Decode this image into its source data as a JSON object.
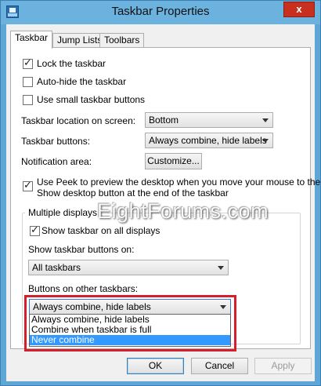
{
  "window": {
    "title": "Taskbar Properties",
    "close_label": "x",
    "icon": "taskbar-window-icon"
  },
  "tabs": [
    {
      "label": "Taskbar",
      "active": true
    },
    {
      "label": "Jump Lists",
      "active": false
    },
    {
      "label": "Toolbars",
      "active": false
    }
  ],
  "options": {
    "lock_taskbar": {
      "label": "Lock the taskbar",
      "checked": true
    },
    "auto_hide": {
      "label": "Auto-hide the taskbar",
      "checked": false
    },
    "small_buttons": {
      "label": "Use small taskbar buttons",
      "checked": false
    }
  },
  "location": {
    "label": "Taskbar location on screen:",
    "value": "Bottom"
  },
  "buttons_setting": {
    "label": "Taskbar buttons:",
    "value": "Always combine, hide labels"
  },
  "notification": {
    "label": "Notification area:",
    "button_label": "Customize..."
  },
  "peek": {
    "label_line1": "Use Peek to preview the desktop when you move your mouse to the",
    "label_line2": "Show desktop button at the end of the taskbar",
    "checked": true
  },
  "multiple_displays": {
    "group_title": "Multiple displays",
    "show_all": {
      "label": "Show taskbar on all displays",
      "checked": true
    },
    "show_buttons_on_label": "Show taskbar buttons on:",
    "show_buttons_on_value": "All taskbars",
    "other_taskbars_label": "Buttons on other taskbars:",
    "other_taskbars_value": "Always combine, hide labels",
    "dropdown_options": [
      {
        "label": "Always combine, hide labels",
        "selected": false
      },
      {
        "label": "Combine when taskbar is full",
        "selected": false
      },
      {
        "label": "Never combine",
        "selected": true
      }
    ]
  },
  "watermark": "EightForums.com",
  "footer": {
    "ok_label": "OK",
    "cancel_label": "Cancel",
    "apply_label": "Apply"
  },
  "colors": {
    "title_bar": "#6cb2de",
    "close_button": "#c7301e",
    "highlight_border": "#d41f2c",
    "selection": "#3399ff"
  }
}
